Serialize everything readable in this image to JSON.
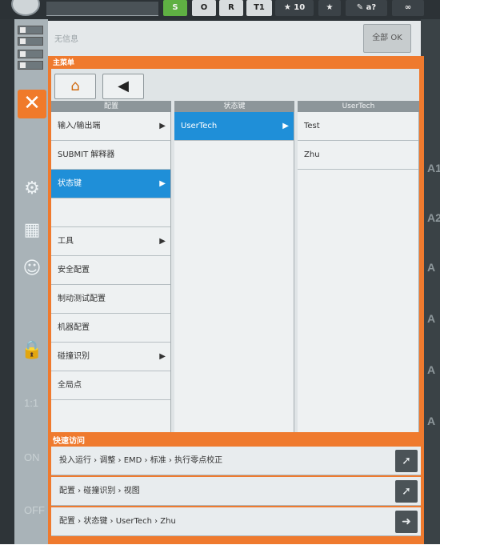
{
  "topbar": {
    "btn_s": "S",
    "btn_o": "O",
    "btn_r": "R",
    "btn_mode": "T1",
    "speed": "10",
    "btn_a2": "a?"
  },
  "leftstrip": {
    "label_ratio": "1:1",
    "label_on": "ON",
    "label_off": "OFF"
  },
  "info": {
    "message": "无信息",
    "all_ok": "全部 OK"
  },
  "rightstrip": {
    "labels": [
      "A1",
      "A2",
      "A",
      "A",
      "A",
      "A"
    ]
  },
  "main_menu": {
    "title": "主菜单",
    "columns": [
      {
        "header": "配置",
        "items": [
          {
            "label": "输入/输出端",
            "arrow": "▶"
          },
          {
            "label": "SUBMIT 解释器",
            "arrow": ""
          },
          {
            "label": "状态键",
            "arrow": "▶"
          },
          {
            "label": "",
            "arrow": ""
          },
          {
            "label": "工具",
            "arrow": "▶"
          },
          {
            "label": "安全配置",
            "arrow": ""
          },
          {
            "label": "制动测试配置",
            "arrow": ""
          },
          {
            "label": "机器配置",
            "arrow": ""
          },
          {
            "label": "碰撞识别",
            "arrow": "▶"
          },
          {
            "label": "全局点",
            "arrow": ""
          }
        ]
      },
      {
        "header": "状态键",
        "items": [
          {
            "label": "UserTech",
            "arrow": "▶"
          }
        ]
      },
      {
        "header": "UserTech",
        "items": [
          {
            "label": "Test",
            "arrow": ""
          },
          {
            "label": "Zhu",
            "arrow": ""
          }
        ]
      }
    ]
  },
  "quick_access": {
    "title": "快速访问",
    "rows": [
      "投入运行 › 调整 › EMD › 标准 › 执行零点校正",
      "配置 › 碰撞识别 › 视图",
      "配置 › 状态键 › UserTech › Zhu"
    ]
  },
  "icons": {
    "home": "home-icon",
    "back": "back-arrow-icon",
    "close": "close-icon",
    "pin": "pin-icon"
  },
  "colors": {
    "accent_orange": "#ef7a2e",
    "selection_blue": "#1f8fd8",
    "run_green": "#5fb043"
  }
}
